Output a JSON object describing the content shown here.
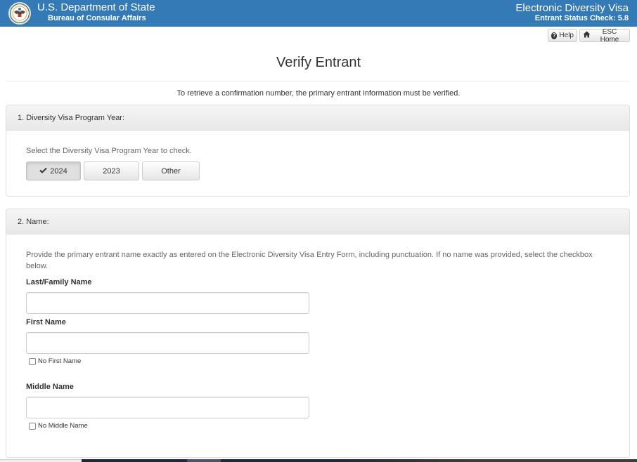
{
  "header": {
    "title": "U.S. Department of State",
    "subtitle": "Bureau of Consular Affairs",
    "right_title": "Electronic Diversity Visa",
    "right_subtitle": "Entrant Status Check: 5.8",
    "brand_color": "#337ab7"
  },
  "toolbar": {
    "help_label": "Help",
    "help_icon": "question-circle-icon",
    "home_label": "ESC Home",
    "home_icon": "home-icon"
  },
  "page": {
    "title": "Verify Entrant",
    "intro": "To retrieve a confirmation number, the primary entrant information must be verified."
  },
  "section1": {
    "heading": "1. Diversity Visa Program Year:",
    "help": "Select the Diversity Visa Program Year to check.",
    "years": [
      {
        "label": "2024",
        "selected": true
      },
      {
        "label": "2023",
        "selected": false
      },
      {
        "label": "Other",
        "selected": false
      }
    ]
  },
  "section2": {
    "heading": "2. Name:",
    "help": "Provide the primary entrant name exactly as entered on the Electronic Diversity Visa Entry Form, including punctuation. If no name was provided, select the checkbox below.",
    "last_name": {
      "label": "Last/Family Name",
      "value": "",
      "placeholder": ""
    },
    "first_name": {
      "label": "First Name",
      "value": "",
      "placeholder": "",
      "checkbox_label": "No First Name",
      "checked": false
    },
    "middle_name": {
      "label": "Middle Name",
      "value": "",
      "placeholder": "",
      "checkbox_label": "No Middle Name",
      "checked": false
    }
  }
}
